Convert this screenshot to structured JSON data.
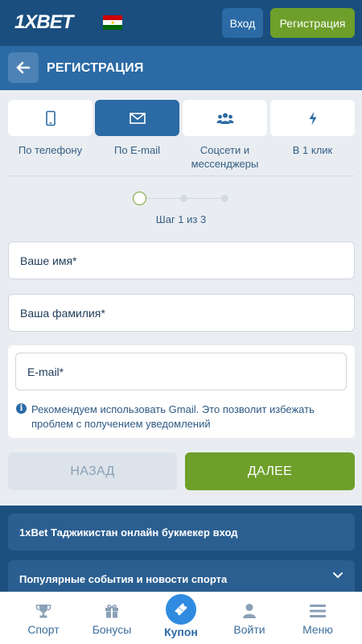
{
  "header": {
    "logo_text": "1XBET",
    "login_label": "Вход",
    "register_label": "Регистрация",
    "flag_icon": "tajikistan-flag-icon"
  },
  "titlebar": {
    "title": "РЕГИСТРАЦИЯ",
    "back_icon": "arrow-left-icon"
  },
  "tabs": [
    {
      "label": "По телефону",
      "icon": "phone-icon",
      "active": false
    },
    {
      "label": "По E-mail",
      "icon": "envelope-icon",
      "active": true
    },
    {
      "label": "Соцсети и мессенджеры",
      "icon": "users-icon",
      "active": false
    },
    {
      "label": "В 1 клик",
      "icon": "lightning-icon",
      "active": false
    }
  ],
  "steps": {
    "text": "Шаг 1 из 3",
    "current": 1,
    "total": 3
  },
  "form": {
    "first_name_placeholder": "Ваше имя*",
    "last_name_placeholder": "Ваша фамилия*",
    "email_placeholder": "E-mail*",
    "hint": "Рекомендуем использовать Gmail. Это позволит избежать проблем с получением уведомлений"
  },
  "actions": {
    "back_label": "НАЗАД",
    "next_label": "ДАЛЕЕ"
  },
  "footer": {
    "items": [
      {
        "label": "1xBet Таджикистан онлайн букмекер вход"
      },
      {
        "label": "Популярные события и новости спорта"
      }
    ]
  },
  "bottom_nav": {
    "items": [
      {
        "label": "Спорт",
        "icon": "trophy-icon"
      },
      {
        "label": "Бонусы",
        "icon": "gift-icon"
      },
      {
        "label": "Купон",
        "icon": "ticket-icon"
      },
      {
        "label": "Войти",
        "icon": "user-icon"
      },
      {
        "label": "Меню",
        "icon": "menu-icon"
      }
    ]
  },
  "colors": {
    "header_bg": "#1a4e7f",
    "primary": "#2b6aa5",
    "accent_green": "#6e9f2a"
  }
}
